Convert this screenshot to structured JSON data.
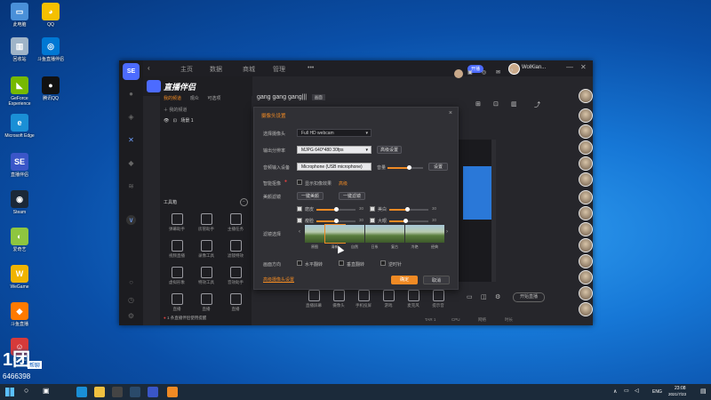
{
  "desktop_icons": [
    {
      "label": "此电脑",
      "color": "#4a90d9",
      "glyph": "▭",
      "icon": "computer-icon"
    },
    {
      "label": "QQ",
      "color": "#f5c000",
      "glyph": "◕",
      "icon": "qq-yellow-icon"
    },
    {
      "label": "回收站",
      "color": "#9fb4c8",
      "glyph": "▥",
      "icon": "recycle-bin-icon"
    },
    {
      "label": "斗鱼直播伴侣",
      "color": "#0078d4",
      "glyph": "◎",
      "icon": "live-companion-icon"
    },
    {
      "label": "GeForce Experience",
      "color": "#76b900",
      "glyph": "◣",
      "icon": "geforce-icon"
    },
    {
      "label": "腾讯QQ",
      "color": "#111111",
      "glyph": "●",
      "icon": "qq-penguin-icon"
    },
    {
      "label": "Microsoft Edge",
      "color": "#1a8fd6",
      "glyph": "e",
      "icon": "edge-icon"
    },
    {
      "label": "直播伴侣",
      "color": "#3a56c8",
      "glyph": "SE",
      "icon": "stream-companion-icon"
    },
    {
      "label": "Steam",
      "color": "#1b2838",
      "glyph": "◉",
      "icon": "steam-icon"
    },
    {
      "label": "爱奇艺",
      "color": "#8ec63f",
      "glyph": "◐",
      "icon": "iqiyi-icon"
    },
    {
      "label": "WeGame",
      "color": "#f0b400",
      "glyph": "W",
      "icon": "wegame-icon"
    },
    {
      "label": "斗鱼直播",
      "color": "#ff7a00",
      "glyph": "◆",
      "icon": "douyu-icon"
    },
    {
      "label": "DouYu",
      "color": "#d63a3a",
      "glyph": "☺",
      "icon": "douyu-mascot-icon"
    }
  ],
  "watermark": {
    "brand": "1团",
    "sub": "帮聊",
    "id": "6466398"
  },
  "app": {
    "logo": "SE",
    "brand": "直播伴侣",
    "nav": [
      "主页",
      "数据",
      "商城",
      "管理"
    ],
    "more": "•••",
    "badge": "开播",
    "user": "WolKian..."
  },
  "stream_panel": {
    "tabs": [
      "我的频道",
      "观众",
      "可选项"
    ],
    "group": "我的频道",
    "scene": "场景 1",
    "tools_title": "工具箱",
    "tools": [
      [
        "弹幕助手",
        "房管助手",
        "主播任务"
      ],
      [
        "视频直播",
        "录像工具",
        "滤镜特效"
      ],
      [
        "虚拟形象",
        "特效工具",
        "音效助手"
      ],
      [
        "直播",
        "直播",
        "直播"
      ]
    ],
    "notice": "1 条直播伴侣使用提醒"
  },
  "editor": {
    "title": "gang gang gang|||",
    "tag": "画面"
  },
  "dialog": {
    "title": "摄像头设置",
    "close": "×",
    "rows": {
      "camera_label": "选择摄像头",
      "camera_value": "Full HD webcam",
      "resolution_label": "输出分辨率",
      "resolution_value": "MJPG 640*480 30fps",
      "resolution_btn": "高级设置",
      "audio_label": "音频输入设备",
      "audio_value": "Microphone (USB microphone)",
      "audio_volume": "音量",
      "audio_btn": "设置",
      "smart_label": "智能抠像",
      "smart_check": "显示扣像效果",
      "smart_link": "高级",
      "beauty_label": "美颜滤镜",
      "beauty_btn1": "一键美颜",
      "beauty_btn2": "一键滤镜",
      "sliders": [
        {
          "name": "磨皮",
          "value": 0.5,
          "num": "30"
        },
        {
          "name": "美白",
          "value": 0.45,
          "num": "30"
        },
        {
          "name": "瘦脸",
          "value": 0.5,
          "num": "30"
        },
        {
          "name": "大眼",
          "value": 0.4,
          "num": "30"
        }
      ],
      "filter_label": "滤镜选择",
      "filters": [
        "原图",
        "清新",
        "自然",
        "日系",
        "复古",
        "冷艳",
        "经典"
      ],
      "flip_label": "画面方向",
      "flip_opts": [
        "水平翻转",
        "垂直翻转",
        "逆时针"
      ],
      "advanced_link": "高级摄像头设置",
      "ok": "确定",
      "cancel": "取消"
    }
  },
  "bottom_tools": [
    "直播屏幕",
    "摄像头",
    "手机投屏",
    "游戏",
    "麦克风",
    "提示音"
  ],
  "right_col": {
    "btn": "开始直播"
  },
  "status_bar": [
    "TAR 1",
    "CPU",
    "网络",
    "时长"
  ],
  "taskbar": {
    "lang": "ENG",
    "time": "23:08",
    "date": "2021/7/23"
  },
  "colors": {
    "accent": "#f08a24",
    "brand": "#4c6bff",
    "taskbar": "#1b2a3a"
  }
}
